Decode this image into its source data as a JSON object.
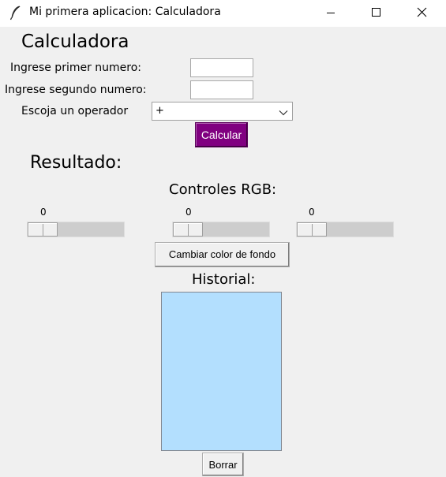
{
  "window": {
    "title": "Mi primera aplicacion: Calculadora",
    "controls": [
      "minimize",
      "maximize",
      "close"
    ]
  },
  "calculator": {
    "heading": "Calculadora",
    "first_number_label": "Ingrese primer numero:",
    "first_number_value": "",
    "second_number_label": "Ingrese segundo numero:",
    "second_number_value": "",
    "operator_label": "Escoja un operador",
    "operator_selected": "+",
    "calculate_label": "Calcular",
    "result_label": "Resultado:"
  },
  "rgb": {
    "heading": "Controles RGB:",
    "scales": [
      {
        "name": "red",
        "value": "0"
      },
      {
        "name": "green",
        "value": "0"
      },
      {
        "name": "blue",
        "value": "0"
      }
    ],
    "scale_range": [
      0,
      255
    ],
    "apply_label": "Cambiar color de fondo"
  },
  "history": {
    "heading": "Historial:",
    "items": [],
    "background": "#b3dffe",
    "clear_label": "Borrar"
  },
  "colors": {
    "window_bg": "#f0f0f0",
    "calculate_button_bg": "#800080",
    "calculate_button_fg": "#ffffff",
    "history_bg": "#b3dffe"
  },
  "icons": {
    "app": "feather-icon",
    "operator_dropdown": "chevron-down-icon"
  }
}
